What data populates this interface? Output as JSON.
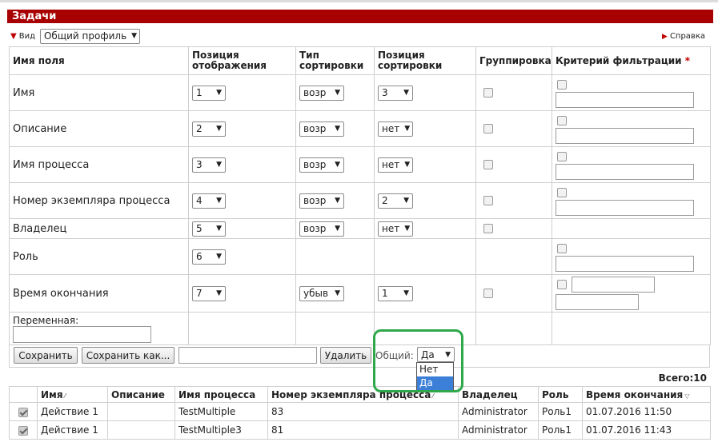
{
  "title": "Задачи",
  "view": {
    "label": "Вид",
    "profile": "Общий профиль"
  },
  "help": "Справка",
  "config": {
    "headers": [
      "Имя поля",
      "Позиция отображения",
      "Тип сортировки",
      "Позиция сортировки",
      "Группировка",
      "Критерий фильтрации"
    ],
    "required_mark": "*",
    "rows": [
      {
        "name": "Имя",
        "pos": "1",
        "sort_type": "возр",
        "sort_pos": "3"
      },
      {
        "name": "Описание",
        "pos": "2",
        "sort_type": "возр",
        "sort_pos": "нет"
      },
      {
        "name": "Имя процесса",
        "pos": "3",
        "sort_type": "возр",
        "sort_pos": "нет"
      },
      {
        "name": "Номер экземпляра процесса",
        "pos": "4",
        "sort_type": "возр",
        "sort_pos": "2"
      },
      {
        "name": "Владелец",
        "pos": "5",
        "sort_type": "возр",
        "sort_pos": "нет"
      },
      {
        "name": "Роль",
        "pos": "6"
      },
      {
        "name": "Время окончания",
        "pos": "7",
        "sort_type": "убыв",
        "sort_pos": "1"
      }
    ],
    "variable_label": "Переменная:"
  },
  "toolbar": {
    "save": "Сохранить",
    "save_as": "Сохранить как...",
    "delete": "Удалить",
    "shared_label": "Общий:",
    "shared_value": "Да",
    "shared_options": [
      "Нет",
      "Да"
    ]
  },
  "total": "Всего:10",
  "grid": {
    "headers": [
      "",
      "Имя",
      "Описание",
      "Имя процесса",
      "Номер экземпляра процесса",
      "Владелец",
      "Роль",
      "Время окончания"
    ],
    "rows": [
      {
        "name": "Действие 1",
        "description": "",
        "process": "TestMultiple",
        "instance": "83",
        "owner": "Administrator",
        "role": "Роль1",
        "end_time": "01.07.2016 11:50"
      },
      {
        "name": "Действие 1",
        "description": "",
        "process": "TestMultiple3",
        "instance": "81",
        "owner": "Administrator",
        "role": "Роль1",
        "end_time": "01.07.2016 11:43"
      }
    ]
  }
}
